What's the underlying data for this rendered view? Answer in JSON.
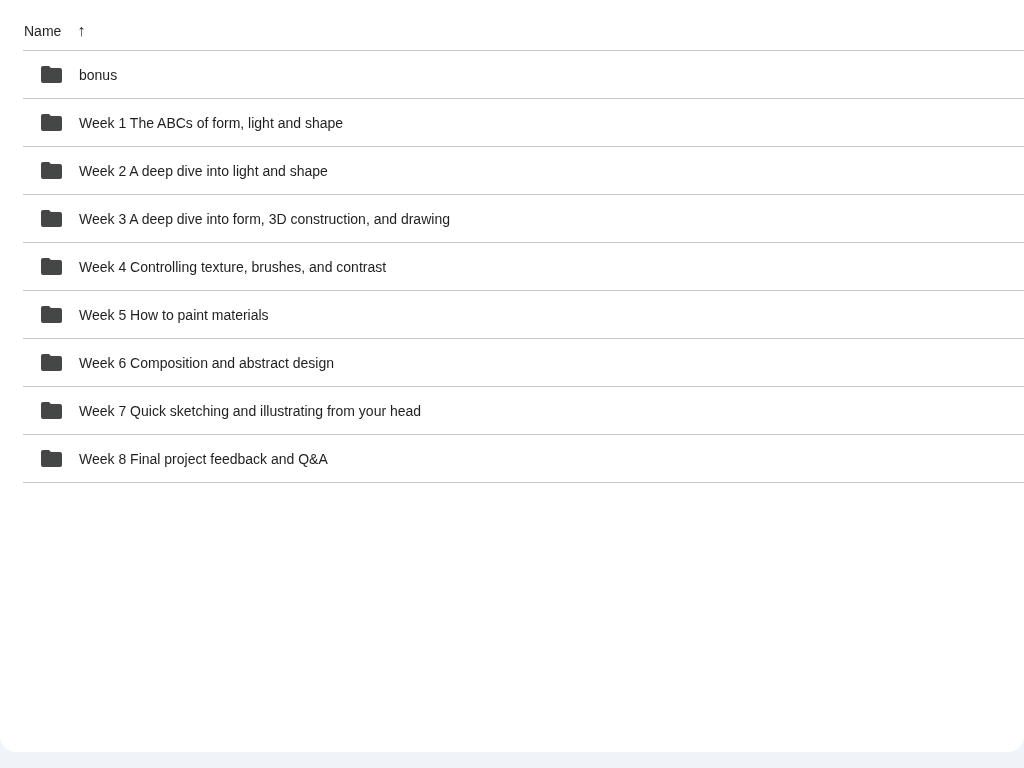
{
  "table": {
    "columns": [
      {
        "label": "Name",
        "ascending": true,
        "sort_icon": "↑"
      }
    ],
    "rows": [
      {
        "kind": "folder",
        "name": "bonus"
      },
      {
        "kind": "folder",
        "name": "Week 1 The ABCs of form, light and shape"
      },
      {
        "kind": "folder",
        "name": "Week 2 A deep dive into light and shape"
      },
      {
        "kind": "folder",
        "name": "Week 3 A deep dive into form, 3D construction, and drawing"
      },
      {
        "kind": "folder",
        "name": "Week 4 Controlling texture, brushes, and contrast"
      },
      {
        "kind": "folder",
        "name": "Week 5 How to paint materials"
      },
      {
        "kind": "folder",
        "name": "Week 6 Composition and abstract design"
      },
      {
        "kind": "folder",
        "name": "Week 7 Quick sketching and illustrating from your head"
      },
      {
        "kind": "folder",
        "name": "Week 8 Final project feedback and Q&A"
      }
    ]
  }
}
